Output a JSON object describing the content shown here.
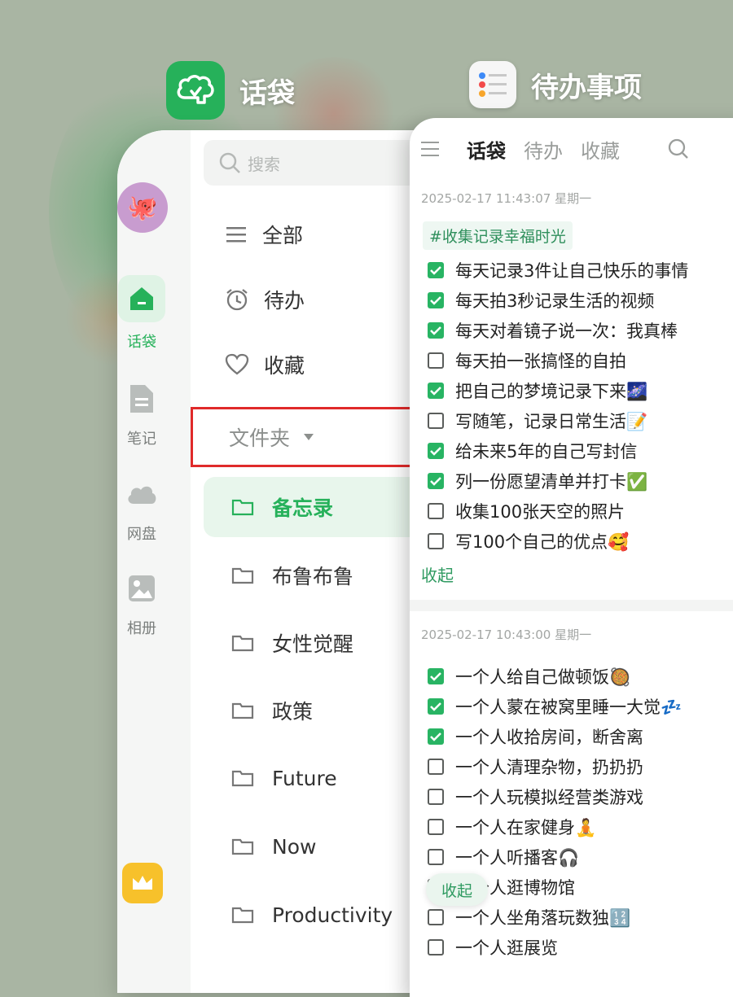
{
  "apps": {
    "huadai": {
      "title": "话袋"
    },
    "todo": {
      "title": "待办事项"
    }
  },
  "colors": {
    "accent": "#26b15a",
    "highlight_border": "#e02a2a",
    "background": "#a9b5a3"
  },
  "left": {
    "search_placeholder": "搜索",
    "rail": [
      {
        "label": "话袋",
        "icon": "home-icon",
        "active": true
      },
      {
        "label": "笔记",
        "icon": "note-icon"
      },
      {
        "label": "网盘",
        "icon": "cloud-icon"
      },
      {
        "label": "相册",
        "icon": "photo-icon"
      }
    ],
    "menu": [
      {
        "label": "全部",
        "icon": "list-icon"
      },
      {
        "label": "待办",
        "icon": "alarm-clock-icon"
      },
      {
        "label": "收藏",
        "icon": "heart-icon"
      }
    ],
    "folder_header": "文件夹",
    "folders": [
      "备忘录",
      "布鲁布鲁",
      "女性觉醒",
      "政策",
      "Future",
      "Now",
      "Productivity"
    ]
  },
  "right": {
    "tabs": [
      "话袋",
      "待办",
      "收藏"
    ],
    "blocks": [
      {
        "timestamp": "2025-02-17 11:43:07 星期一",
        "tag": "#收集记录幸福时光",
        "items": [
          {
            "text": "每天记录3件让自己快乐的事情",
            "done": true
          },
          {
            "text": "每天拍3秒记录生活的视频",
            "done": true
          },
          {
            "text": "每天对着镜子说一次：我真棒",
            "done": true
          },
          {
            "text": "每天拍一张搞怪的自拍",
            "done": false
          },
          {
            "text": "把自己的梦境记录下来🌌",
            "done": true
          },
          {
            "text": "写随笔，记录日常生活📝",
            "done": false
          },
          {
            "text": "给未来5年的自己写封信",
            "done": true
          },
          {
            "text": "列一份愿望清单并打卡✅",
            "done": true
          },
          {
            "text": "收集100张天空的照片",
            "done": false
          },
          {
            "text": "写100个自己的优点🥰",
            "done": false
          }
        ],
        "collapse_label": "收起"
      },
      {
        "timestamp": "2025-02-17 10:43:00 星期一",
        "items": [
          {
            "text": "一个人给自己做顿饭🥘",
            "done": true
          },
          {
            "text": "一个人蒙在被窝里睡一大觉💤",
            "done": true
          },
          {
            "text": "一个人收拾房间，断舍离",
            "done": true
          },
          {
            "text": "一个人清理杂物，扔扔扔",
            "done": false
          },
          {
            "text": "一个人玩模拟经营类游戏",
            "done": false
          },
          {
            "text": "一个人在家健身🧘",
            "done": false
          },
          {
            "text": "一个人听播客🎧",
            "done": false
          },
          {
            "text": "一个人逛博物馆",
            "done": false
          },
          {
            "text": "一个人坐角落玩数独🔢",
            "done": false
          },
          {
            "text": "一个人逛展览",
            "done": false
          }
        ],
        "collapse_label": "收起"
      }
    ]
  }
}
